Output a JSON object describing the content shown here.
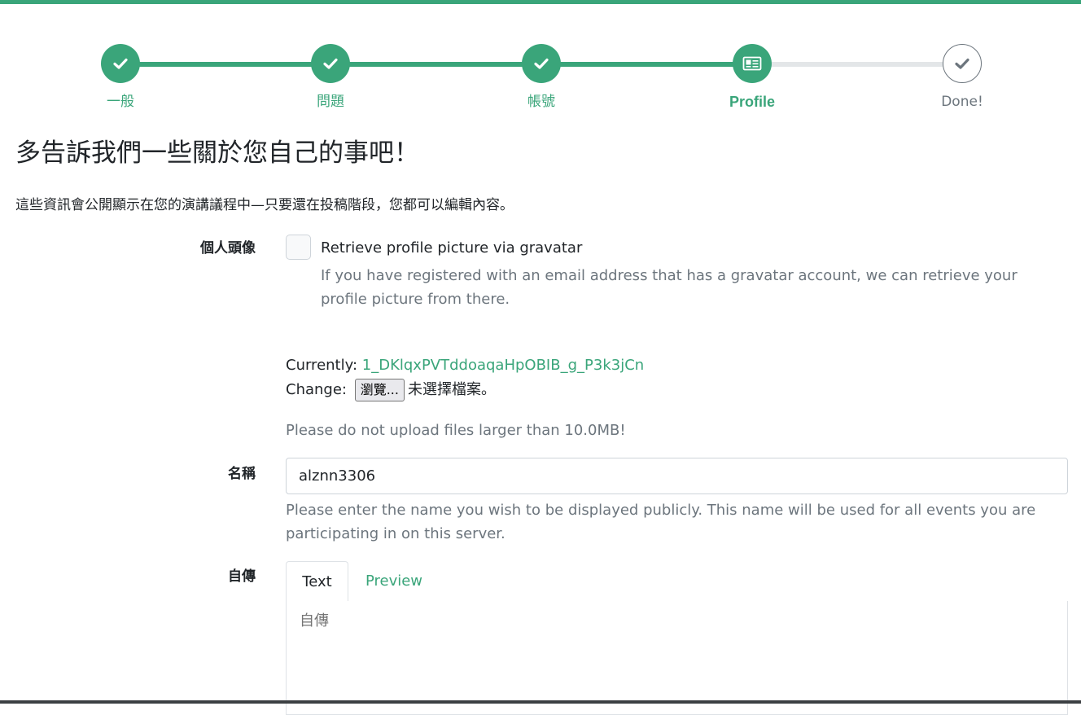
{
  "stepper": {
    "steps": [
      {
        "label": "一般",
        "state": "done",
        "icon": "check-icon"
      },
      {
        "label": "問題",
        "state": "done",
        "icon": "check-icon"
      },
      {
        "label": "帳號",
        "state": "done",
        "icon": "check-icon"
      },
      {
        "label": "Profile",
        "state": "active",
        "icon": "id-card-icon"
      },
      {
        "label": "Done!",
        "state": "future",
        "icon": "check-icon"
      }
    ]
  },
  "page": {
    "title": "多告訴我們一些關於您自己的事吧！",
    "lead": "這些資訊會公開顯示在您的演講議程中—只要還在投稿階段，您都可以編輯內容。"
  },
  "avatar": {
    "label": "個人頭像",
    "gravatar_label": "Retrieve profile picture via gravatar",
    "gravatar_help": "If you have registered with an email address that has a gravatar account, we can retrieve your profile picture from there.",
    "currently_label": "Currently:",
    "current_file": "1_DKlqxPVTddoaqaHpOBIB_g_P3k3jCn",
    "change_label": "Change:",
    "browse_label": "瀏覽...",
    "no_file": "未選擇檔案。",
    "size_help": "Please do not upload files larger than 10.0MB!"
  },
  "name": {
    "label": "名稱",
    "value": "alznn3306",
    "help": "Please enter the name you wish to be displayed publicly. This name will be used for all events you are participating in on this server."
  },
  "bio": {
    "label": "自傳",
    "tab_text": "Text",
    "tab_preview": "Preview",
    "placeholder": "自傳"
  },
  "colors": {
    "accent": "#3aa57a",
    "muted": "#6c757d",
    "track_inactive": "#e3e6e8"
  }
}
